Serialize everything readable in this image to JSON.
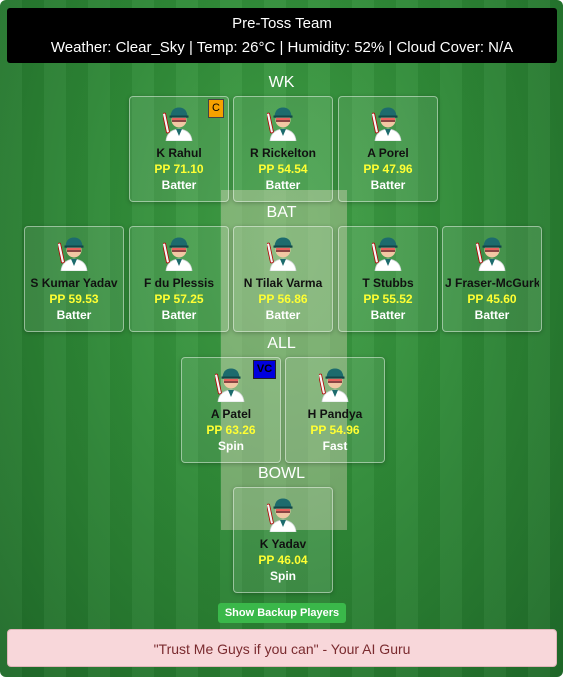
{
  "header": {
    "title": "Pre-Toss Team",
    "weather": "Weather: Clear_Sky | Temp: 26°C | Humidity: 52% | Cloud Cover: N/A"
  },
  "sections": {
    "wk": "WK",
    "bat": "BAT",
    "all": "ALL",
    "bowl": "BOWL"
  },
  "players": [
    {
      "name": "K Rahul",
      "pp": "PP 71.10",
      "role": "Batter",
      "badge": "C",
      "avatar_icon": "cricket-batter-avatar-icon"
    },
    {
      "name": "R Rickelton",
      "pp": "PP 54.54",
      "role": "Batter",
      "badge": "",
      "avatar_icon": "cricket-batter-avatar-icon"
    },
    {
      "name": "A Porel",
      "pp": "PP 47.96",
      "role": "Batter",
      "badge": "",
      "avatar_icon": "cricket-batter-avatar-icon"
    },
    {
      "name": "S Kumar Yadav",
      "pp": "PP 59.53",
      "role": "Batter",
      "badge": "",
      "avatar_icon": "cricket-batsman-avatar-icon"
    },
    {
      "name": "F du Plessis",
      "pp": "PP 57.25",
      "role": "Batter",
      "badge": "",
      "avatar_icon": "cricket-batsman-avatar-icon"
    },
    {
      "name": "N Tilak Varma",
      "pp": "PP 56.86",
      "role": "Batter",
      "badge": "",
      "avatar_icon": "cricket-batsman-avatar-icon"
    },
    {
      "name": "T Stubbs",
      "pp": "PP 55.52",
      "role": "Batter",
      "badge": "",
      "avatar_icon": "cricket-batsman-avatar-icon"
    },
    {
      "name": "J Fraser-McGurk",
      "pp": "PP 45.60",
      "role": "Batter",
      "badge": "",
      "avatar_icon": "cricket-batsman-avatar-icon"
    },
    {
      "name": "A Patel",
      "pp": "PP 63.26",
      "role": "Spin",
      "badge": "VC",
      "avatar_icon": "cricket-allrounder-avatar-icon"
    },
    {
      "name": "H Pandya",
      "pp": "PP 54.96",
      "role": "Fast",
      "badge": "",
      "avatar_icon": "cricket-allrounder-avatar-icon"
    },
    {
      "name": "K Yadav",
      "pp": "PP 46.04",
      "role": "Spin",
      "badge": "",
      "avatar_icon": "cricket-bowler-avatar-icon"
    }
  ],
  "backup_button": "Show Backup Players",
  "quote": "\"Trust Me Guys if you can\" - Your AI Guru"
}
